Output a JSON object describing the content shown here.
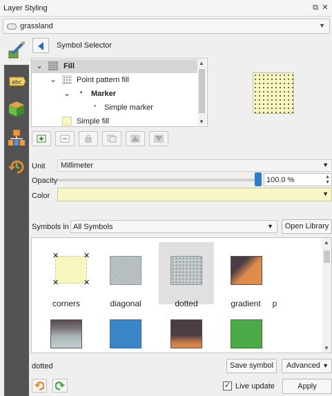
{
  "window": {
    "title": "Layer Styling"
  },
  "layer": {
    "name": "grassland"
  },
  "selector": {
    "title": "Symbol Selector"
  },
  "tree": {
    "items": [
      {
        "label": "Fill"
      },
      {
        "label": "Point pattern fill"
      },
      {
        "label": "Marker"
      },
      {
        "label": "Simple marker"
      },
      {
        "label": "Simple fill"
      }
    ]
  },
  "properties": {
    "unit_label": "Unit",
    "unit_value": "Millimeter",
    "opacity_label": "Opacity",
    "opacity_value": "100.0 %",
    "opacity_fraction": 1.0,
    "color_label": "Color",
    "color_value": "#f7f6c6"
  },
  "library": {
    "symbols_in_label": "Symbols in",
    "symbols_in_value": "All Symbols",
    "open_library": "Open Library",
    "symbols": [
      {
        "label": "corners"
      },
      {
        "label": "diagonal"
      },
      {
        "label": "dotted"
      },
      {
        "label": "gradient"
      },
      {
        "label": "p"
      }
    ]
  },
  "footer": {
    "selected_symbol": "dotted",
    "save_symbol": "Save symbol",
    "advanced": "Advanced",
    "live_update": "Live update",
    "apply": "Apply"
  },
  "colors": {
    "accent": "#2b7ccc",
    "sidebar": "#535353",
    "fill_yellow": "#f6f7bf"
  }
}
